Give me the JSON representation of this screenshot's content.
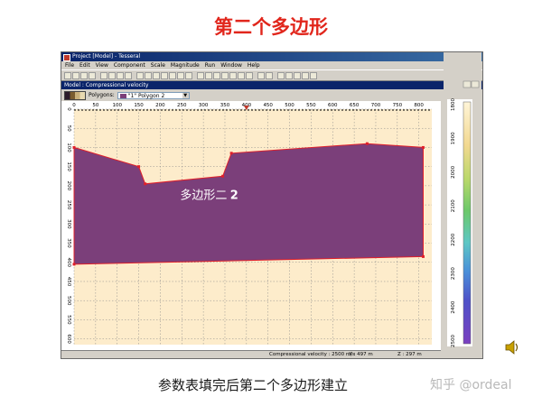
{
  "slide": {
    "title": "第二个多边形",
    "caption": "参数表填完后第二个多边形建立",
    "watermark": "知乎 @ordeal"
  },
  "window": {
    "title": "Project [Model] - Tesseral",
    "menu": [
      "File",
      "Edit",
      "View",
      "Component",
      "Scale",
      "Magnitude",
      "Run",
      "Window",
      "Help"
    ],
    "panel_title": "Model : Compressional velocity",
    "polygon_label": "Polygons:",
    "polygon_selected": "\"1\" Polygon 2",
    "polygon_color": "#7b3f7a"
  },
  "model": {
    "x_ticks": [
      "0",
      "50",
      "100",
      "150",
      "200",
      "250",
      "300",
      "350",
      "400",
      "450",
      "500",
      "550",
      "600",
      "650",
      "700",
      "750",
      "800"
    ],
    "y_ticks": [
      "0",
      "50",
      "100",
      "150",
      "200",
      "250",
      "300",
      "350",
      "400",
      "450",
      "500",
      "550",
      "600"
    ],
    "x_range": [
      0,
      830
    ],
    "y_range": [
      0,
      615
    ],
    "polygon_top": [
      [
        0,
        100
      ],
      [
        150,
        150
      ],
      [
        165,
        195
      ],
      [
        345,
        175
      ],
      [
        365,
        115
      ],
      [
        680,
        90
      ],
      [
        810,
        100
      ]
    ],
    "polygon_bottom": [
      [
        810,
        385
      ],
      [
        0,
        405
      ]
    ],
    "polygon_label": "多边形二",
    "polygon_number": "2",
    "background_color": "#fdeccb",
    "outline_color": "#e0202a"
  },
  "colorbar": {
    "labels": [
      "1800",
      "1900",
      "2000",
      "2100",
      "2200",
      "2300",
      "2400",
      "2500"
    ]
  },
  "status": {
    "velocity": "Compressional velocity : 2500 m/s",
    "x": "X : 497 m",
    "z": "Z : 297 m"
  }
}
